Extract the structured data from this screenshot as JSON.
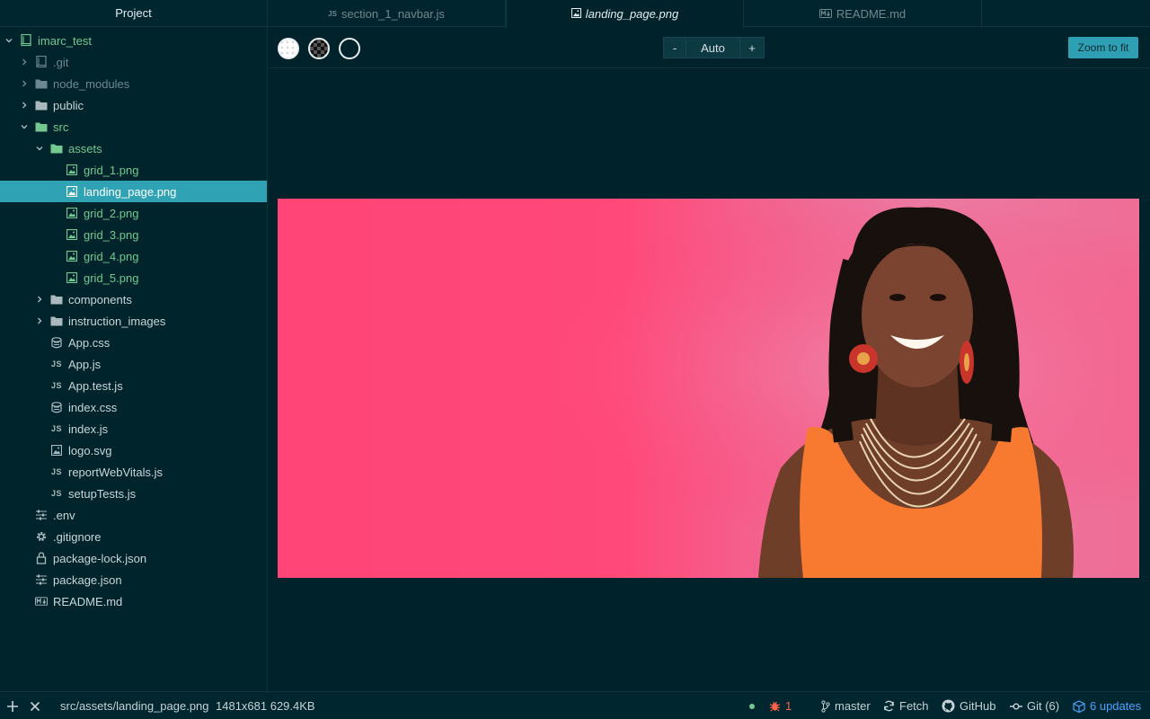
{
  "sidebar": {
    "title": "Project",
    "tree": [
      {
        "label": "imarc_test",
        "depth": 0,
        "arrow": "down",
        "icon": "repo-icon",
        "color": "green"
      },
      {
        "label": ".git",
        "depth": 1,
        "arrow": "right",
        "icon": "repo-icon",
        "color": "dim"
      },
      {
        "label": "node_modules",
        "depth": 1,
        "arrow": "right",
        "icon": "folder-icon",
        "color": "dim"
      },
      {
        "label": "public",
        "depth": 1,
        "arrow": "right",
        "icon": "folder-icon",
        "color": "normal"
      },
      {
        "label": "src",
        "depth": 1,
        "arrow": "down",
        "icon": "folder-icon",
        "color": "green"
      },
      {
        "label": "assets",
        "depth": 2,
        "arrow": "down",
        "icon": "folder-icon",
        "color": "green"
      },
      {
        "label": "grid_1.png",
        "depth": 3,
        "arrow": "",
        "icon": "image-icon",
        "color": "green"
      },
      {
        "label": "landing_page.png",
        "depth": 3,
        "arrow": "",
        "icon": "image-icon",
        "color": "selected"
      },
      {
        "label": "grid_2.png",
        "depth": 3,
        "arrow": "",
        "icon": "image-icon",
        "color": "green"
      },
      {
        "label": "grid_3.png",
        "depth": 3,
        "arrow": "",
        "icon": "image-icon",
        "color": "green"
      },
      {
        "label": "grid_4.png",
        "depth": 3,
        "arrow": "",
        "icon": "image-icon",
        "color": "green"
      },
      {
        "label": "grid_5.png",
        "depth": 3,
        "arrow": "",
        "icon": "image-icon",
        "color": "green"
      },
      {
        "label": "components",
        "depth": 2,
        "arrow": "right",
        "icon": "folder-icon",
        "color": "normal"
      },
      {
        "label": "instruction_images",
        "depth": 2,
        "arrow": "right",
        "icon": "folder-icon",
        "color": "normal"
      },
      {
        "label": "App.css",
        "depth": 2,
        "arrow": "",
        "icon": "css-icon",
        "color": "normal"
      },
      {
        "label": "App.js",
        "depth": 2,
        "arrow": "",
        "icon": "js-icon",
        "color": "normal"
      },
      {
        "label": "App.test.js",
        "depth": 2,
        "arrow": "",
        "icon": "js-icon",
        "color": "normal"
      },
      {
        "label": "index.css",
        "depth": 2,
        "arrow": "",
        "icon": "css-icon",
        "color": "normal"
      },
      {
        "label": "index.js",
        "depth": 2,
        "arrow": "",
        "icon": "js-icon",
        "color": "normal"
      },
      {
        "label": "logo.svg",
        "depth": 2,
        "arrow": "",
        "icon": "image-icon",
        "color": "normal"
      },
      {
        "label": "reportWebVitals.js",
        "depth": 2,
        "arrow": "",
        "icon": "js-icon",
        "color": "normal"
      },
      {
        "label": "setupTests.js",
        "depth": 2,
        "arrow": "",
        "icon": "js-icon",
        "color": "normal"
      },
      {
        "label": ".env",
        "depth": 1,
        "arrow": "",
        "icon": "settings-sliders-icon",
        "color": "normal"
      },
      {
        "label": ".gitignore",
        "depth": 1,
        "arrow": "",
        "icon": "gear-icon",
        "color": "normal"
      },
      {
        "label": "package-lock.json",
        "depth": 1,
        "arrow": "",
        "icon": "lock-icon",
        "color": "normal"
      },
      {
        "label": "package.json",
        "depth": 1,
        "arrow": "",
        "icon": "settings-sliders-icon",
        "color": "normal"
      },
      {
        "label": "README.md",
        "depth": 1,
        "arrow": "",
        "icon": "markdown-icon",
        "color": "normal"
      }
    ]
  },
  "tabs": [
    {
      "label": "section_1_navbar.js",
      "icon": "js-icon",
      "active": false
    },
    {
      "label": "landing_page.png",
      "icon": "image-icon",
      "active": true
    },
    {
      "label": "README.md",
      "icon": "markdown-icon",
      "active": false
    }
  ],
  "toolbar": {
    "zoom_out": "-",
    "zoom_level": "Auto",
    "zoom_in": "+",
    "zoom_fit": "Zoom to fit"
  },
  "statusbar": {
    "path": "src/assets/landing_page.png",
    "image_info": "1481x681 629.4KB",
    "issues_count": "1",
    "branch": "master",
    "fetch": "Fetch",
    "github": "GitHub",
    "git": "Git (6)",
    "updates": "6 updates"
  },
  "colors": {
    "accent": "#2fa3b4",
    "vcs_added": "#73c990",
    "issue": "#ff6347",
    "updates": "#4aa3ff"
  }
}
